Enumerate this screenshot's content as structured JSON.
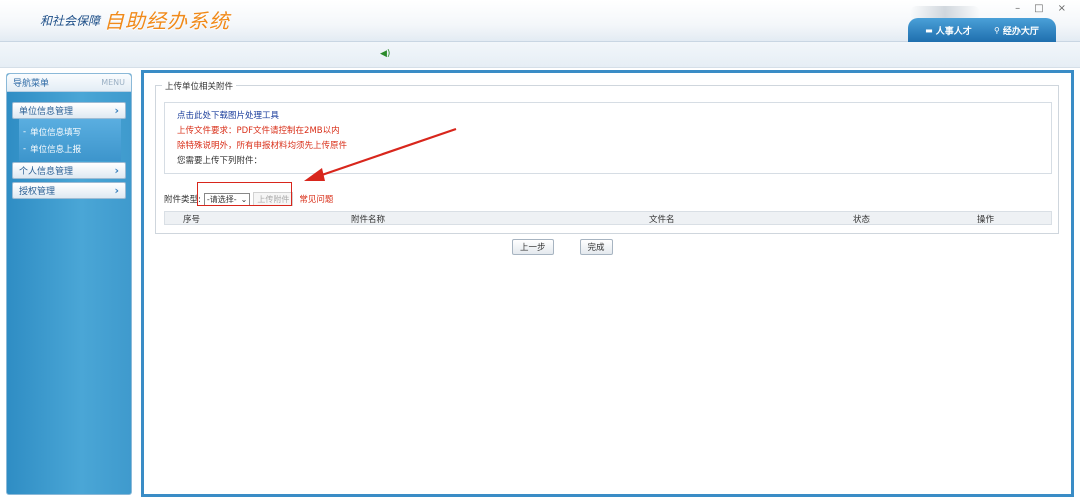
{
  "header": {
    "brand_small": "和社会保障",
    "brand_large": "自助经办系统",
    "tabs": [
      {
        "icon": "person-icon",
        "label": "人事人才"
      },
      {
        "icon": "hall-icon",
        "label": "经办大厅"
      }
    ],
    "window_controls": [
      "–",
      "□",
      "×"
    ]
  },
  "sidebar": {
    "title": "导航菜单",
    "title_en": "MENU",
    "groups": [
      {
        "label": "单位信息管理",
        "subitems": [
          "单位信息填写",
          "单位信息上报"
        ]
      },
      {
        "label": "个人信息管理"
      },
      {
        "label": "授权管理"
      }
    ]
  },
  "main": {
    "legend": "上传单位相关附件",
    "info": {
      "download_tool": "点击此处下载图片处理工具",
      "requirement": "上传文件要求：PDF文件请控制在2MB以内",
      "note": "除特殊说明外，所有申报材料均须先上传原件",
      "prompt": "您需要上传下列附件："
    },
    "type_label": "附件类型:",
    "type_select_value": "-请选择-",
    "upload_button": "上传附件",
    "faq_link": "常见问题",
    "table_columns": [
      "序号",
      "附件名称",
      "文件名",
      "状态",
      "操作"
    ],
    "buttons": {
      "prev": "上一步",
      "finish": "完成"
    }
  },
  "colors": {
    "accent": "#3a8cc6",
    "annotation": "#d8261c",
    "brand": "#f08a1a"
  }
}
